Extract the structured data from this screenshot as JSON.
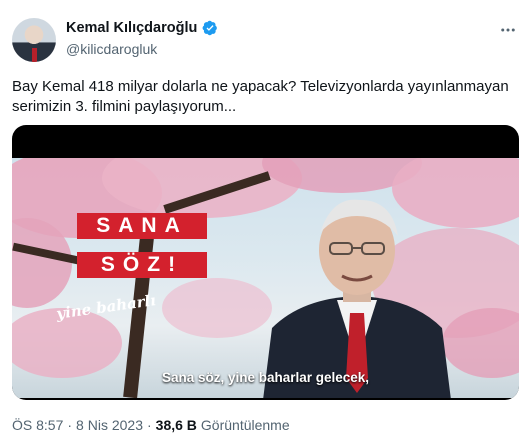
{
  "author": {
    "name": "Kemal Kılıçdaroğlu",
    "handle": "@kilicdarogluk"
  },
  "tweet": {
    "text": "Bay Kemal 418 milyar dolarla ne yapacak? Televizyonlarda yayınlanmayan serimizin 3. filmini paylaşıyorum..."
  },
  "video": {
    "overlay_line1": "SANA",
    "overlay_line2": "SÖZ!",
    "overlay_script": "yine baharlı",
    "subtitle": "Sana söz, yine baharlar gelecek,"
  },
  "meta": {
    "time": "ÖS 8:57",
    "sep1": "·",
    "date": "8 Nis 2023",
    "sep2": "·",
    "views_count": "38,6 B",
    "views_label": "Görüntülenme"
  },
  "colors": {
    "verified": "#1d9bf0",
    "red_box": "#d3212d",
    "text_primary": "#0f1419",
    "text_secondary": "#536471"
  },
  "icons": [
    "verified-badge-icon",
    "more-options-icon"
  ]
}
